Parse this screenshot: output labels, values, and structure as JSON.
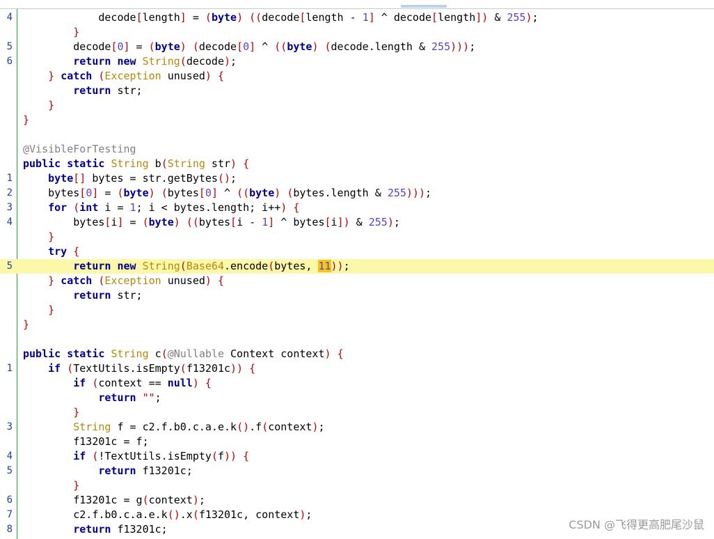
{
  "editor": {
    "lines": [
      {
        "n": "4",
        "segs": [
          [
            "t",
            "            decode"
          ],
          [
            "p",
            "["
          ],
          [
            "t",
            "length"
          ],
          [
            "p",
            "]"
          ],
          [
            "t",
            " = "
          ],
          [
            "p",
            "("
          ],
          [
            "kw",
            "byte"
          ],
          [
            "p",
            ")"
          ],
          [
            "t",
            " "
          ],
          [
            "p",
            "(("
          ],
          [
            "t",
            "decode"
          ],
          [
            "p",
            "["
          ],
          [
            "t",
            "length - "
          ],
          [
            "nu",
            "1"
          ],
          [
            "p",
            "]"
          ],
          [
            "t",
            " ^ decode"
          ],
          [
            "p",
            "["
          ],
          [
            "t",
            "length"
          ],
          [
            "p",
            "])"
          ],
          [
            "t",
            " & "
          ],
          [
            "nu",
            "255"
          ],
          [
            "p",
            ")"
          ],
          [
            "t",
            ";"
          ]
        ]
      },
      {
        "n": "",
        "segs": [
          [
            "t",
            "        "
          ],
          [
            "p",
            "}"
          ]
        ]
      },
      {
        "n": "5",
        "segs": [
          [
            "t",
            "        decode"
          ],
          [
            "p",
            "["
          ],
          [
            "nu",
            "0"
          ],
          [
            "p",
            "]"
          ],
          [
            "t",
            " = "
          ],
          [
            "p",
            "("
          ],
          [
            "kw",
            "byte"
          ],
          [
            "p",
            ")"
          ],
          [
            "t",
            " "
          ],
          [
            "p",
            "("
          ],
          [
            "t",
            "decode"
          ],
          [
            "p",
            "["
          ],
          [
            "nu",
            "0"
          ],
          [
            "p",
            "]"
          ],
          [
            "t",
            " ^ "
          ],
          [
            "p",
            "(("
          ],
          [
            "kw",
            "byte"
          ],
          [
            "p",
            ")"
          ],
          [
            "t",
            " "
          ],
          [
            "p",
            "("
          ],
          [
            "t",
            "decode.length & "
          ],
          [
            "nu",
            "255"
          ],
          [
            "p",
            ")))"
          ],
          [
            "t",
            ";"
          ]
        ]
      },
      {
        "n": "6",
        "segs": [
          [
            "t",
            "        "
          ],
          [
            "kw",
            "return new"
          ],
          [
            "t",
            " "
          ],
          [
            "ty",
            "String"
          ],
          [
            "p",
            "("
          ],
          [
            "t",
            "decode"
          ],
          [
            "p",
            ")"
          ],
          [
            "t",
            ";"
          ]
        ]
      },
      {
        "n": "",
        "segs": [
          [
            "t",
            "    "
          ],
          [
            "p",
            "}"
          ],
          [
            "t",
            " "
          ],
          [
            "kw",
            "catch"
          ],
          [
            "t",
            " "
          ],
          [
            "p",
            "("
          ],
          [
            "ty",
            "Exception"
          ],
          [
            "t",
            " unused"
          ],
          [
            "p",
            ")"
          ],
          [
            "t",
            " "
          ],
          [
            "p",
            "{"
          ]
        ]
      },
      {
        "n": "",
        "segs": [
          [
            "t",
            "        "
          ],
          [
            "kw",
            "return"
          ],
          [
            "t",
            " str;"
          ]
        ]
      },
      {
        "n": "",
        "segs": [
          [
            "t",
            "    "
          ],
          [
            "p",
            "}"
          ]
        ]
      },
      {
        "n": "",
        "segs": [
          [
            "t",
            ""
          ],
          [
            "p",
            "}"
          ]
        ]
      },
      {
        "n": "",
        "segs": [
          [
            "t",
            ""
          ]
        ]
      },
      {
        "n": "",
        "segs": [
          [
            "an",
            "@VisibleForTesting"
          ]
        ]
      },
      {
        "n": "",
        "segs": [
          [
            "kw",
            "public static"
          ],
          [
            "t",
            " "
          ],
          [
            "ty",
            "String"
          ],
          [
            "t",
            " b"
          ],
          [
            "p",
            "("
          ],
          [
            "ty",
            "String"
          ],
          [
            "t",
            " str"
          ],
          [
            "p",
            ")"
          ],
          [
            "t",
            " "
          ],
          [
            "p",
            "{"
          ]
        ]
      },
      {
        "n": "1",
        "segs": [
          [
            "t",
            "    "
          ],
          [
            "kw",
            "byte"
          ],
          [
            "p",
            "[]"
          ],
          [
            "t",
            " bytes = str.getBytes"
          ],
          [
            "p",
            "()"
          ],
          [
            "t",
            ";"
          ]
        ]
      },
      {
        "n": "2",
        "segs": [
          [
            "t",
            "    bytes"
          ],
          [
            "p",
            "["
          ],
          [
            "nu",
            "0"
          ],
          [
            "p",
            "]"
          ],
          [
            "t",
            " = "
          ],
          [
            "p",
            "("
          ],
          [
            "kw",
            "byte"
          ],
          [
            "p",
            ")"
          ],
          [
            "t",
            " "
          ],
          [
            "p",
            "("
          ],
          [
            "t",
            "bytes"
          ],
          [
            "p",
            "["
          ],
          [
            "nu",
            "0"
          ],
          [
            "p",
            "]"
          ],
          [
            "t",
            " ^ "
          ],
          [
            "p",
            "(("
          ],
          [
            "kw",
            "byte"
          ],
          [
            "p",
            ")"
          ],
          [
            "t",
            " "
          ],
          [
            "p",
            "("
          ],
          [
            "t",
            "bytes.length & "
          ],
          [
            "nu",
            "255"
          ],
          [
            "p",
            ")))"
          ],
          [
            "t",
            ";"
          ]
        ]
      },
      {
        "n": "3",
        "segs": [
          [
            "t",
            "    "
          ],
          [
            "kw",
            "for"
          ],
          [
            "t",
            " "
          ],
          [
            "p",
            "("
          ],
          [
            "kw",
            "int"
          ],
          [
            "t",
            " i = "
          ],
          [
            "nu",
            "1"
          ],
          [
            "t",
            "; i < bytes.length; i++"
          ],
          [
            "p",
            ")"
          ],
          [
            "t",
            " "
          ],
          [
            "p",
            "{"
          ]
        ]
      },
      {
        "n": "4",
        "segs": [
          [
            "t",
            "        bytes"
          ],
          [
            "p",
            "["
          ],
          [
            "t",
            "i"
          ],
          [
            "p",
            "]"
          ],
          [
            "t",
            " = "
          ],
          [
            "p",
            "("
          ],
          [
            "kw",
            "byte"
          ],
          [
            "p",
            ")"
          ],
          [
            "t",
            " "
          ],
          [
            "p",
            "(("
          ],
          [
            "t",
            "bytes"
          ],
          [
            "p",
            "["
          ],
          [
            "t",
            "i - "
          ],
          [
            "nu",
            "1"
          ],
          [
            "p",
            "]"
          ],
          [
            "t",
            " ^ bytes"
          ],
          [
            "p",
            "["
          ],
          [
            "t",
            "i"
          ],
          [
            "p",
            "])"
          ],
          [
            "t",
            " & "
          ],
          [
            "nu",
            "255"
          ],
          [
            "p",
            ")"
          ],
          [
            "t",
            ";"
          ]
        ]
      },
      {
        "n": "",
        "segs": [
          [
            "t",
            "    "
          ],
          [
            "p",
            "}"
          ]
        ]
      },
      {
        "n": "",
        "segs": [
          [
            "t",
            "    "
          ],
          [
            "kw",
            "try"
          ],
          [
            "t",
            " "
          ],
          [
            "p",
            "{"
          ]
        ]
      },
      {
        "n": "5",
        "hl": true,
        "segs": [
          [
            "t",
            "        "
          ],
          [
            "kw",
            "return new"
          ],
          [
            "t",
            " "
          ],
          [
            "ty",
            "String"
          ],
          [
            "p",
            "("
          ],
          [
            "ty",
            "Base64"
          ],
          [
            "t",
            ".encode"
          ],
          [
            "p",
            "("
          ],
          [
            "t",
            "bytes, "
          ],
          [
            "m",
            "11"
          ],
          [
            "p",
            "))"
          ],
          [
            "t",
            ";"
          ]
        ]
      },
      {
        "n": "",
        "segs": [
          [
            "t",
            "    "
          ],
          [
            "p",
            "}"
          ],
          [
            "t",
            " "
          ],
          [
            "kw",
            "catch"
          ],
          [
            "t",
            " "
          ],
          [
            "p",
            "("
          ],
          [
            "ty",
            "Exception"
          ],
          [
            "t",
            " unused"
          ],
          [
            "p",
            ")"
          ],
          [
            "t",
            " "
          ],
          [
            "p",
            "{"
          ]
        ]
      },
      {
        "n": "",
        "segs": [
          [
            "t",
            "        "
          ],
          [
            "kw",
            "return"
          ],
          [
            "t",
            " str;"
          ]
        ]
      },
      {
        "n": "",
        "segs": [
          [
            "t",
            "    "
          ],
          [
            "p",
            "}"
          ]
        ]
      },
      {
        "n": "",
        "segs": [
          [
            "t",
            ""
          ],
          [
            "p",
            "}"
          ]
        ]
      },
      {
        "n": "",
        "segs": [
          [
            "t",
            ""
          ]
        ]
      },
      {
        "n": "",
        "segs": [
          [
            "kw",
            "public static"
          ],
          [
            "t",
            " "
          ],
          [
            "ty",
            "String"
          ],
          [
            "t",
            " c"
          ],
          [
            "p",
            "("
          ],
          [
            "an",
            "@Nullable"
          ],
          [
            "t",
            " Context context"
          ],
          [
            "p",
            ")"
          ],
          [
            "t",
            " "
          ],
          [
            "p",
            "{"
          ]
        ]
      },
      {
        "n": "1",
        "segs": [
          [
            "t",
            "    "
          ],
          [
            "kw",
            "if"
          ],
          [
            "t",
            " "
          ],
          [
            "p",
            "("
          ],
          [
            "t",
            "TextUtils.isEmpty"
          ],
          [
            "p",
            "("
          ],
          [
            "t",
            "f13201c"
          ],
          [
            "p",
            "))"
          ],
          [
            "t",
            " "
          ],
          [
            "p",
            "{"
          ]
        ]
      },
      {
        "n": "",
        "segs": [
          [
            "t",
            "        "
          ],
          [
            "kw",
            "if"
          ],
          [
            "t",
            " "
          ],
          [
            "p",
            "("
          ],
          [
            "t",
            "context == "
          ],
          [
            "kw",
            "null"
          ],
          [
            "p",
            ")"
          ],
          [
            "t",
            " "
          ],
          [
            "p",
            "{"
          ]
        ]
      },
      {
        "n": "",
        "segs": [
          [
            "t",
            "            "
          ],
          [
            "kw",
            "return"
          ],
          [
            "t",
            " "
          ],
          [
            "p",
            "\"\""
          ],
          [
            "t",
            ";"
          ]
        ]
      },
      {
        "n": "",
        "segs": [
          [
            "t",
            "        "
          ],
          [
            "p",
            "}"
          ]
        ]
      },
      {
        "n": "3",
        "segs": [
          [
            "t",
            "        "
          ],
          [
            "ty",
            "String"
          ],
          [
            "t",
            " f = c2.f.b0.c.a.e.k"
          ],
          [
            "p",
            "()"
          ],
          [
            "t",
            ".f"
          ],
          [
            "p",
            "("
          ],
          [
            "t",
            "context"
          ],
          [
            "p",
            ")"
          ],
          [
            "t",
            ";"
          ]
        ]
      },
      {
        "n": "",
        "segs": [
          [
            "t",
            "        f13201c = f;"
          ]
        ]
      },
      {
        "n": "4",
        "segs": [
          [
            "t",
            "        "
          ],
          [
            "kw",
            "if"
          ],
          [
            "t",
            " "
          ],
          [
            "p",
            "("
          ],
          [
            "t",
            "!TextUtils.isEmpty"
          ],
          [
            "p",
            "("
          ],
          [
            "t",
            "f"
          ],
          [
            "p",
            "))"
          ],
          [
            "t",
            " "
          ],
          [
            "p",
            "{"
          ]
        ]
      },
      {
        "n": "5",
        "segs": [
          [
            "t",
            "            "
          ],
          [
            "kw",
            "return"
          ],
          [
            "t",
            " f13201c;"
          ]
        ]
      },
      {
        "n": "",
        "segs": [
          [
            "t",
            "        "
          ],
          [
            "p",
            "}"
          ]
        ]
      },
      {
        "n": "6",
        "segs": [
          [
            "t",
            "        f13201c = g"
          ],
          [
            "p",
            "("
          ],
          [
            "t",
            "context"
          ],
          [
            "p",
            ")"
          ],
          [
            "t",
            ";"
          ]
        ]
      },
      {
        "n": "7",
        "segs": [
          [
            "t",
            "        c2.f.b0.c.a.e.k"
          ],
          [
            "p",
            "()"
          ],
          [
            "t",
            ".x"
          ],
          [
            "p",
            "("
          ],
          [
            "t",
            "f13201c, context"
          ],
          [
            "p",
            ")"
          ],
          [
            "t",
            ";"
          ]
        ]
      },
      {
        "n": "8",
        "segs": [
          [
            "t",
            "        "
          ],
          [
            "kw",
            "return"
          ],
          [
            "t",
            " f13201c;"
          ]
        ]
      }
    ]
  },
  "watermark": "CSDN @飞得更高肥尾沙鼠",
  "colors": {
    "keyword": "#00008b",
    "type": "#b8860b",
    "number": "#5c3ec8",
    "punct": "#c00000",
    "annotation": "#808080",
    "line_highlight": "#fbf8a9",
    "match_highlight": "#f5c518",
    "gutter_line": "#21a33b"
  }
}
